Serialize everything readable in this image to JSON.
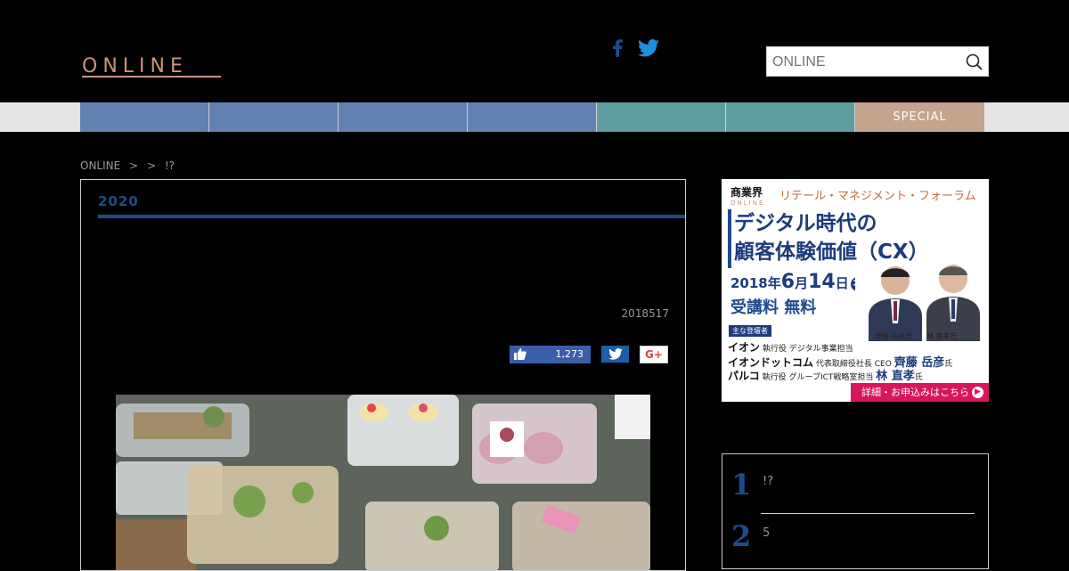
{
  "header": {
    "logo": "ONLINE",
    "search_placeholder": "ONLINE"
  },
  "icons": {
    "facebook": "facebook-icon",
    "twitter": "twitter-icon",
    "search": "search-icon"
  },
  "nav": {
    "items": [
      {
        "label": "",
        "color": "#6181b3"
      },
      {
        "label": "",
        "color": "#6181b3"
      },
      {
        "label": "",
        "color": "#6181b3"
      },
      {
        "label": "",
        "color": "#6181b3"
      },
      {
        "label": "",
        "color": "#5f9ea0"
      },
      {
        "label": "",
        "color": "#5f9ea0"
      },
      {
        "label": "SPECIAL",
        "color": "#c4a48c"
      }
    ]
  },
  "breadcrumb": {
    "items": [
      "ONLINE",
      ">",
      ">",
      "!?"
    ]
  },
  "article": {
    "category": "2020",
    "title": "",
    "date": "2018517",
    "share": {
      "like_count": "1,273",
      "gplus_label": "G+"
    }
  },
  "ad": {
    "logo": "商業界",
    "logo_sub": "ONLINE",
    "forum": "リテール・マネジメント・フォーラム",
    "headline_1": "デジタル時代の",
    "headline_2": "顧客体験価値（CX）",
    "date_prefix": "2018年",
    "date_month": "6",
    "date_mid": "月",
    "date_day": "14",
    "date_suffix": "日",
    "date_weekday": "木",
    "fee_label": "受講料",
    "fee_value": "無料",
    "guests_label": "主な登壇者",
    "speaker_1_name": "齊藤 岳彦氏",
    "speaker_2_name": "林 直孝氏",
    "lines": [
      {
        "company": "イオン",
        "role": "執行役 デジタル事業担当",
        "person": ""
      },
      {
        "company": "イオンドットコム",
        "role": "代表取締役社長 CEO",
        "person": "齊藤 岳彦",
        "suffix": "氏"
      },
      {
        "company": "パルコ",
        "role": "執行役 グループICT戦略室担当",
        "person": "林 直孝",
        "suffix": "氏"
      }
    ],
    "cta": "詳細・お申込みはこちら"
  },
  "ranking": {
    "title": "",
    "items": [
      {
        "rank": "1",
        "text": "!?"
      },
      {
        "rank": "2",
        "text": "5"
      }
    ]
  }
}
